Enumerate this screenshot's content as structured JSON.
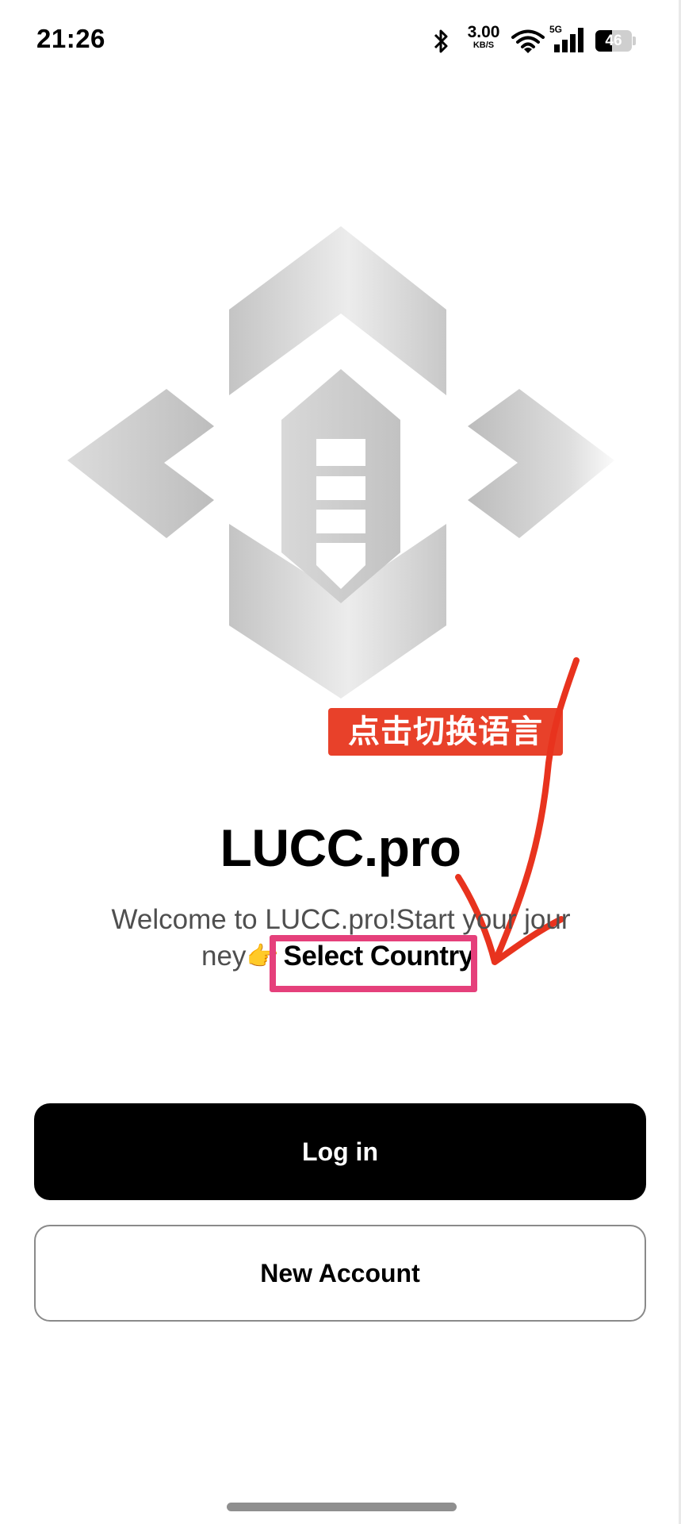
{
  "status_bar": {
    "time": "21:26",
    "net_speed": "3.00",
    "net_speed_unit": "KB/S",
    "network_type": "5G",
    "battery_level": "46",
    "battery_fraction": 0.46,
    "icons": [
      "bluetooth-icon",
      "wifi-icon",
      "signal-icon",
      "battery-icon"
    ]
  },
  "logo": {
    "icon": "app-logo",
    "color": "#d0d0d0"
  },
  "annotation": {
    "label": "点击切换语言",
    "color": "#e8412a"
  },
  "app": {
    "title": "LUCC.pro",
    "welcome_line1": "Welcome to LUCC.pro!Start your jour",
    "welcome_line2": "ney",
    "emoji": "👉",
    "select_country": "Select Country",
    "highlight_color": "#e5407b"
  },
  "buttons": {
    "login_label": "Log in",
    "new_account_label": "New Account"
  }
}
